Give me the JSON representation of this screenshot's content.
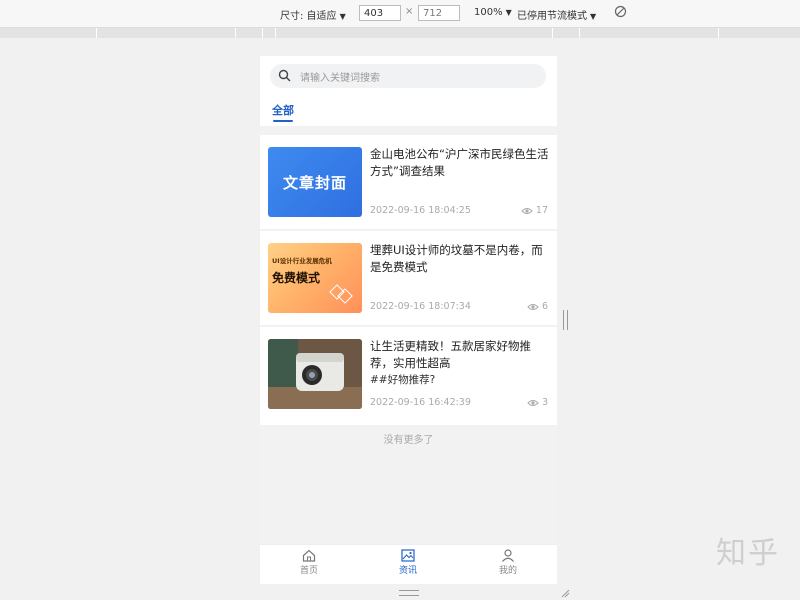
{
  "devtools": {
    "size_label": "尺寸: 自适应",
    "width": "403",
    "times": "×",
    "height": "712",
    "zoom": "100%",
    "throttle": "已停用节流模式"
  },
  "search": {
    "placeholder": "请输入关键词搜索"
  },
  "tabs": [
    {
      "label": "全部"
    }
  ],
  "articles": [
    {
      "title": "金山电池公布“沪广深市民绿色生活方式”调查结果",
      "cover_text": "文章封面",
      "date": "2022-09-16 18:04:25",
      "views": "17"
    },
    {
      "title": "埋葬UI设计师的坟墓不是内卷，而是免费模式",
      "cover_small": "UI设计行业发展危机",
      "cover_big": "免费模式",
      "date": "2022-09-16 18:07:34",
      "views": "6"
    },
    {
      "title": "让生活更精致！五款居家好物推荐，实用性超高",
      "tag": "##好物推荐?",
      "date": "2022-09-16 16:42:39",
      "views": "3"
    }
  ],
  "no_more": "没有更多了",
  "tabbar": [
    {
      "label": "首页"
    },
    {
      "label": "资讯"
    },
    {
      "label": "我的"
    }
  ],
  "watermark": "知乎",
  "colors": {
    "accent": "#2262c6",
    "background": "#f2f2f2"
  }
}
